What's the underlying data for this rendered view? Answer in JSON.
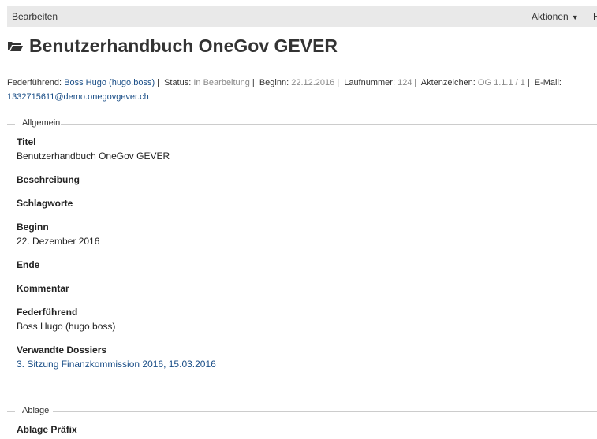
{
  "toolbar": {
    "edit_label": "Bearbeiten",
    "actions_label": "Aktionen",
    "more_label": "H"
  },
  "header": {
    "title": "Benutzerhandbuch OneGov GEVER"
  },
  "meta": {
    "lead_label": "Federführend:",
    "lead_value": "Boss Hugo (hugo.boss)",
    "status_label": "Status:",
    "status_value": "In Bearbeitung",
    "start_label": "Beginn:",
    "start_value": "22.12.2016",
    "seq_label": "Laufnummer:",
    "seq_value": "124",
    "ref_label": "Aktenzeichen:",
    "ref_value": "OG 1.1.1 / 1",
    "email_label": "E-Mail:",
    "email_value": "1332715611@demo.onegovgever.ch"
  },
  "sections": {
    "general": "Allgemein",
    "storage": "Ablage"
  },
  "fields": {
    "title_label": "Titel",
    "title_value": "Benutzerhandbuch OneGov GEVER",
    "description_label": "Beschreibung",
    "keywords_label": "Schlagworte",
    "start_label": "Beginn",
    "start_value": "22. Dezember 2016",
    "end_label": "Ende",
    "comment_label": "Kommentar",
    "lead_label": "Federführend",
    "lead_value": "Boss Hugo (hugo.boss)",
    "related_label": "Verwandte Dossiers",
    "related_value": "3. Sitzung Finanzkommission 2016, 15.03.2016",
    "prefix_label": "Ablage Präfix"
  },
  "colors": {
    "link": "#1a4e87",
    "muted": "#888888",
    "toolbar_bg": "#e9e9e9"
  }
}
